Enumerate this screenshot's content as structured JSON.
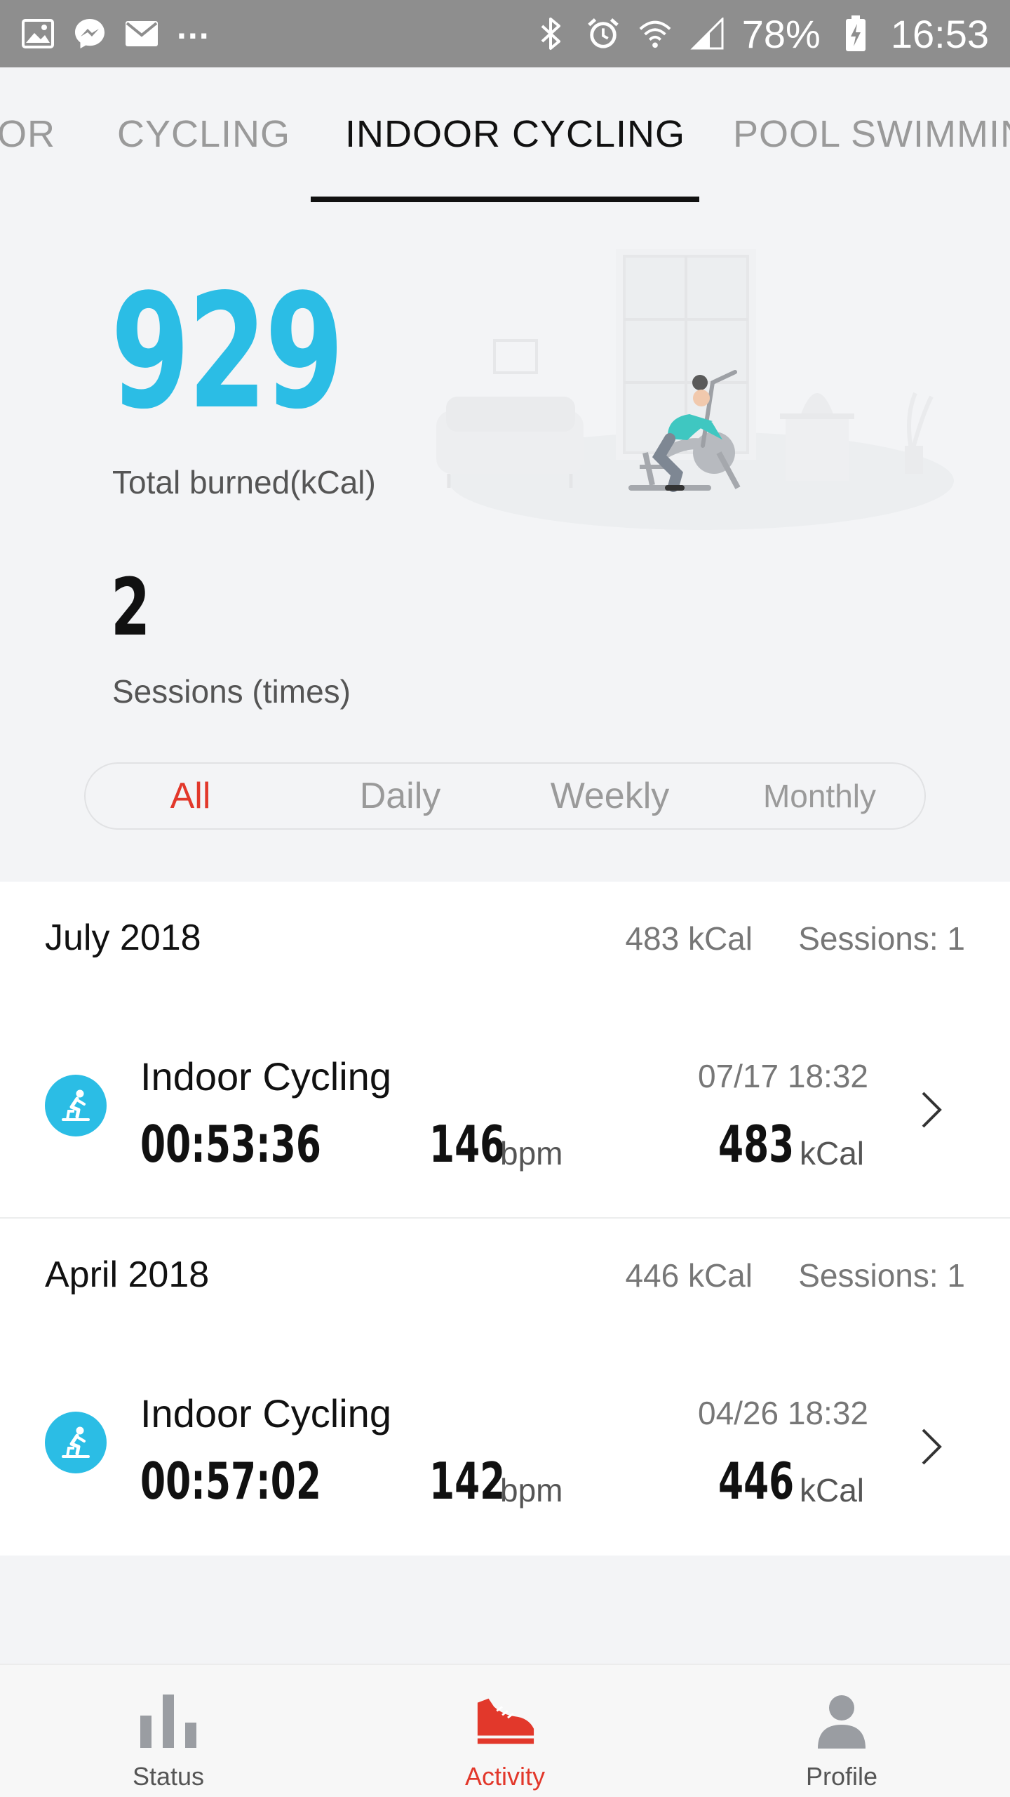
{
  "status_bar": {
    "icons_left": [
      "gallery-icon",
      "messenger-icon",
      "mail-icon"
    ],
    "more": "...",
    "icons_right": [
      "bluetooth-icon",
      "alarm-icon",
      "wifi-icon",
      "signal-icon"
    ],
    "battery": "78%",
    "time": "16:53"
  },
  "tabs": {
    "items": [
      "OR",
      "CYCLING",
      "INDOOR CYCLING",
      "POOL SWIMMIN"
    ],
    "active_index": 2
  },
  "summary": {
    "total_burned": "929",
    "total_burned_label": "Total burned(kCal)",
    "sessions": "2",
    "sessions_label": "Sessions (times)"
  },
  "filter": {
    "options": [
      "All",
      "Daily",
      "Weekly",
      "Monthly"
    ],
    "active": "All"
  },
  "months": [
    {
      "name": "July 2018",
      "kcal": "483 kCal",
      "sessions": "Sessions: 1",
      "activities": [
        {
          "title": "Indoor Cycling",
          "date": "07/17  18:32",
          "duration": "00:53:36",
          "bpm": "146",
          "bpm_unit": "bpm",
          "kcal": "483",
          "kcal_unit": "kCal"
        }
      ]
    },
    {
      "name": "April 2018",
      "kcal": "446 kCal",
      "sessions": "Sessions: 1",
      "activities": [
        {
          "title": "Indoor Cycling",
          "date": "04/26  18:32",
          "duration": "00:57:02",
          "bpm": "142",
          "bpm_unit": "bpm",
          "kcal": "446",
          "kcal_unit": "kCal"
        }
      ]
    }
  ],
  "bottom_nav": [
    {
      "label": "Status",
      "icon": "bar-chart-icon"
    },
    {
      "label": "Activity",
      "icon": "shoe-icon",
      "active": true
    },
    {
      "label": "Profile",
      "icon": "person-icon"
    }
  ],
  "colors": {
    "accent_blue": "#2bbde5",
    "accent_red": "#e2382b"
  }
}
